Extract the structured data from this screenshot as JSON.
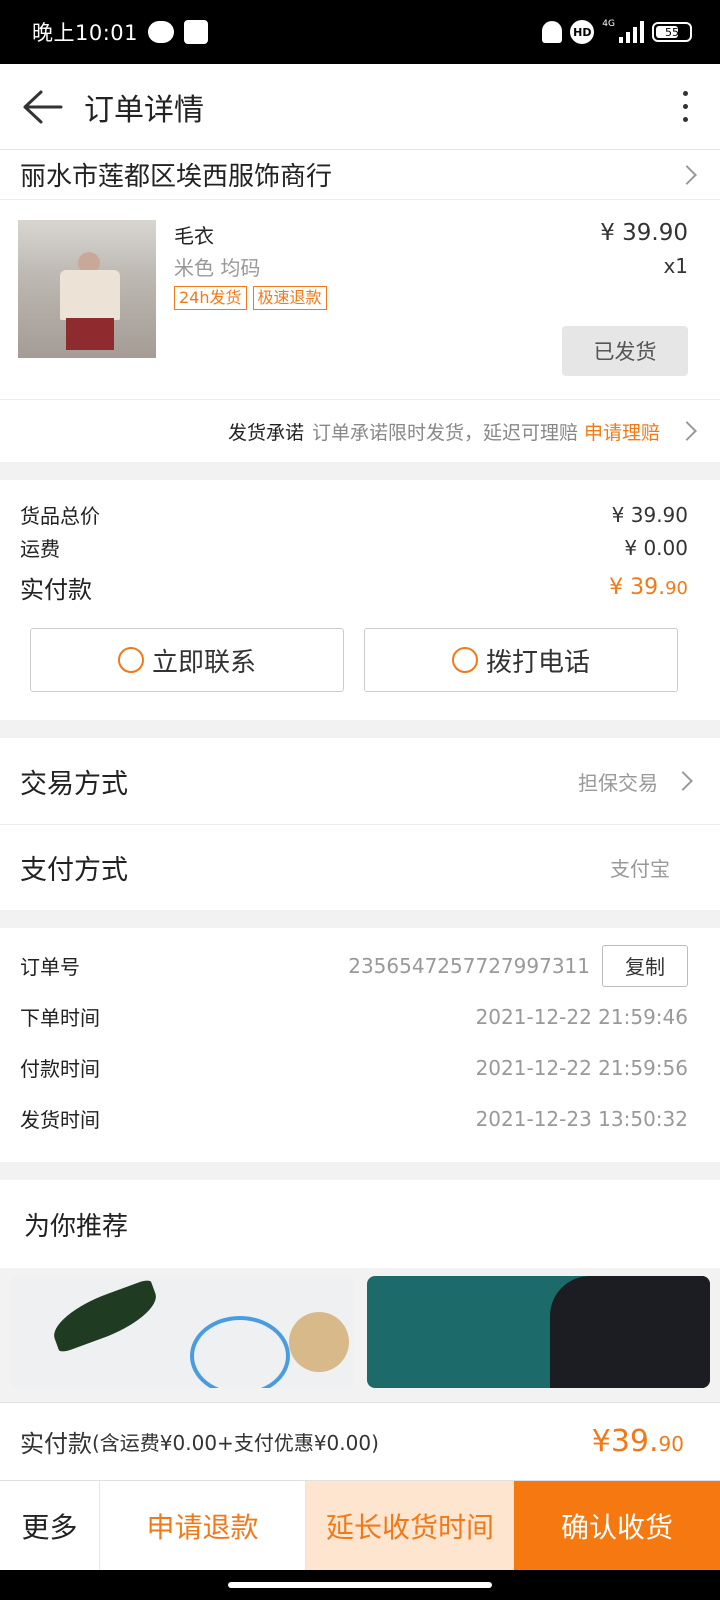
{
  "status_bar": {
    "time": "晚上10:01",
    "network": "4G",
    "battery": "55"
  },
  "nav": {
    "title": "订单详情"
  },
  "shop": {
    "name": "丽水市莲都区埃西服饰商行"
  },
  "item": {
    "name": "毛衣",
    "spec": "米色 均码",
    "tags": [
      "24h发货",
      "极速退款"
    ],
    "price": "¥ 39.90",
    "qty": "x1",
    "status_button": "已发货"
  },
  "promise": {
    "title": "发货承诺",
    "text": "订单承诺限时发货，延迟可理赔",
    "link": "申请理赔"
  },
  "price": {
    "goods_label": "货品总价",
    "goods_value": "¥ 39.90",
    "shipping_label": "运费",
    "shipping_value": "¥ 0.00",
    "paid_label": "实付款",
    "paid_value_main": "¥ 39.",
    "paid_value_decimal": "90"
  },
  "contact": {
    "chat_label": "立即联系",
    "call_label": "拨打电话"
  },
  "trade": {
    "method_label": "交易方式",
    "method_value": "担保交易",
    "payment_label": "支付方式",
    "payment_value": "支付宝"
  },
  "order": {
    "number_label": "订单号",
    "number_value": "2356547257727997311",
    "copy_label": "复制",
    "created_label": "下单时间",
    "created_value": "2021-12-22 21:59:46",
    "paid_label": "付款时间",
    "paid_value": "2021-12-22 21:59:56",
    "shipped_label": "发货时间",
    "shipped_value": "2021-12-23 13:50:32"
  },
  "recommend": {
    "title": "为你推荐"
  },
  "summary": {
    "label": "实付款",
    "note": "(含运费¥0.00+支付优惠¥0.00)",
    "total_main": "¥39.",
    "total_decimal": "90"
  },
  "actions": {
    "more": "更多",
    "refund": "申请退款",
    "extend": "延长收货时间",
    "confirm": "确认收货"
  },
  "colors": {
    "accent": "#f57810",
    "accent_text": "#f07a1a",
    "extend_bg": "#fde5d0"
  }
}
